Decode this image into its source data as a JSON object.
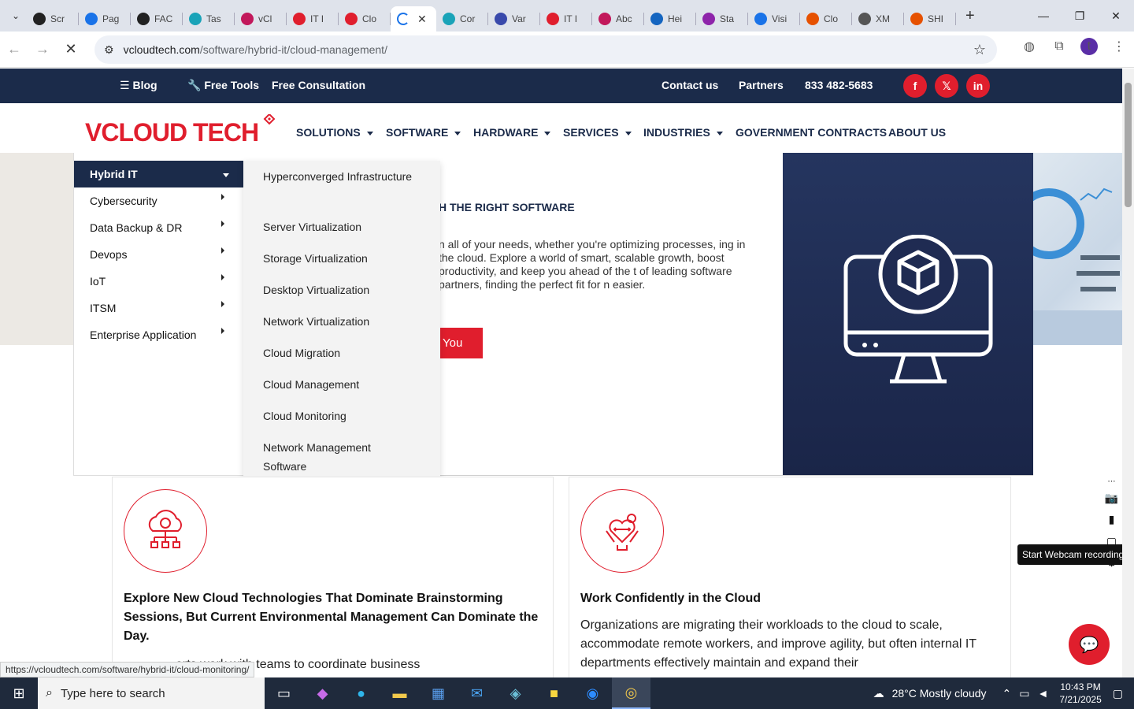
{
  "browser": {
    "tabs": [
      {
        "label": "Scr",
        "color": "#222"
      },
      {
        "label": "Pag",
        "color": "#1a73e8"
      },
      {
        "label": "FAC",
        "color": "#222"
      },
      {
        "label": "Tas",
        "color": "#1aa3b8"
      },
      {
        "label": "vCl",
        "color": "#c2185b"
      },
      {
        "label": "IT I",
        "color": "#e01e2d"
      },
      {
        "label": "Clo",
        "color": "#e01e2d"
      },
      {
        "label": "",
        "color": "#1a73e8",
        "active": true
      },
      {
        "label": "Cor",
        "color": "#1aa3b8"
      },
      {
        "label": "Var",
        "color": "#3949ab"
      },
      {
        "label": "IT I",
        "color": "#e01e2d"
      },
      {
        "label": "Abc",
        "color": "#c2185b"
      },
      {
        "label": "Hei",
        "color": "#1565c0"
      },
      {
        "label": "Sta",
        "color": "#8e24aa"
      },
      {
        "label": "Visi",
        "color": "#1a73e8"
      },
      {
        "label": "Clo",
        "color": "#e65100"
      },
      {
        "label": "XM",
        "color": "#555"
      },
      {
        "label": "SHI",
        "color": "#e65100"
      }
    ],
    "url_host": "vcloudtech.com",
    "url_path": "/software/hybrid-it/cloud-management/",
    "avatar_letter": "t",
    "status_url": "https://vcloudtech.com/software/hybrid-it/cloud-monitoring/"
  },
  "topbar": {
    "blog": "Blog",
    "free_tools": "Free Tools",
    "free_consultation": "Free Consultation",
    "contact": "Contact us",
    "partners": "Partners",
    "phone": "833 482-5683",
    "social": [
      "f",
      "𝕏",
      "in"
    ]
  },
  "nav": {
    "logo_text": "VCLOUD TECH",
    "items": [
      "SOLUTIONS",
      "SOFTWARE",
      "HARDWARE",
      "SERVICES",
      "INDUSTRIES",
      "GOVERNMENT CONTRACTS",
      "ABOUT US"
    ]
  },
  "menu": {
    "left": [
      "Hybrid IT",
      "Cybersecurity",
      "Data Backup & DR",
      "Devops",
      "IoT",
      "ITSM",
      "Enterprise Application"
    ],
    "right": [
      "Hyperconverged Infrastructure",
      "Server Virtualization",
      "Storage Virtualization",
      "Desktop Virtualization",
      "Network Virtualization",
      "Cloud Migration",
      "Cloud Management",
      "Cloud Monitoring",
      "Network Management Software"
    ]
  },
  "hero": {
    "heading": "H THE RIGHT SOFTWARE",
    "para": "n all of your needs, whether you're optimizing processes, ing in the cloud. Explore a world of smart, scalable growth, boost productivity, and keep you ahead of the t of leading software partners, finding the perfect fit for n easier.",
    "button": "You"
  },
  "cards": [
    {
      "title": "Explore New Cloud Technologies That Dominate Brainstorming Sessions, But Current Environmental Management Can Dominate the Day.",
      "body": "erts work with teams to coordinate business"
    },
    {
      "title": "Work Confidently in the Cloud",
      "body": "Organizations are migrating their workloads to the cloud to scale, accommodate remote workers, and improve agility, but often internal IT departments effectively maintain and expand their"
    }
  ],
  "widget": {
    "tooltip": "Start Webcam recording"
  },
  "taskbar": {
    "search_placeholder": "Type here to search",
    "weather": "28°C  Mostly cloudy",
    "time": "10:43 PM",
    "date": "7/21/2025"
  },
  "colors": {
    "brand_navy": "#1b2b4a",
    "brand_red": "#e01e2d"
  }
}
